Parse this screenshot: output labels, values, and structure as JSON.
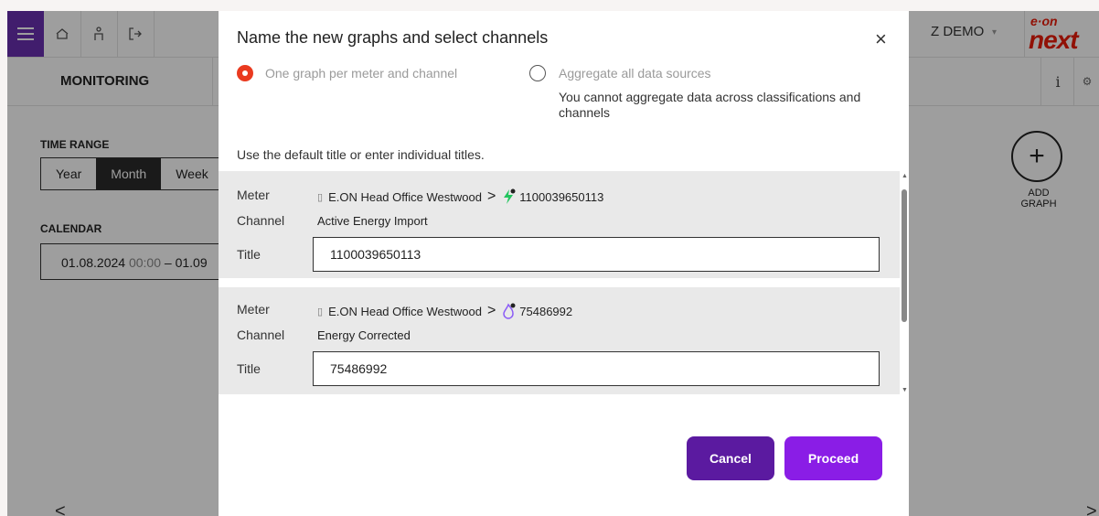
{
  "colors": {
    "brand_purple": "#6a2fb0",
    "eon_red": "#ea1c0a",
    "radio_active": "#ea3a1f",
    "cancel_bg": "#5b1aa0",
    "proceed_bg": "#8a1de6",
    "electricity_icon": "#22c55e",
    "gas_icon": "#8b5cf6"
  },
  "topbar": {
    "icons": [
      "menu-icon",
      "home-icon",
      "user-icon",
      "logout-icon"
    ],
    "account_label": "Z DEMO",
    "account_arrow": "▾",
    "logo_top": "e·on",
    "logo_bottom": "next"
  },
  "section": {
    "title": "MONITORING",
    "info_label": "i",
    "settings_label": "⚙"
  },
  "time_range": {
    "label": "TIME RANGE",
    "options": [
      "Year",
      "Month",
      "Week"
    ],
    "selected": "Month"
  },
  "calendar": {
    "label": "CALENDAR",
    "start_date": "01.08.2024",
    "start_time": "00:00",
    "separator": " – ",
    "end_date_partial": "01.09"
  },
  "add_graph": {
    "icon": "+",
    "label_line1": "ADD",
    "label_line2": "GRAPH"
  },
  "nav": {
    "prev": "<",
    "next": ">"
  },
  "modal": {
    "title": "Name the new graphs and select channels",
    "close": "×",
    "options": [
      {
        "label": "One graph per meter and channel",
        "selected": true
      },
      {
        "label": "Aggregate all data sources",
        "selected": false
      }
    ],
    "aggregate_note": "You cannot aggregate data across classifications and channels",
    "hint": "Use the default title or enter individual titles.",
    "field_labels": {
      "meter": "Meter",
      "channel": "Channel",
      "title": "Title"
    },
    "entries": [
      {
        "site": "E.ON Head Office Westwood",
        "separator": ">",
        "meter_icon": "electricity-icon",
        "meter_id": "1100039650113",
        "channel": "Active Energy Import",
        "title": "1100039650113"
      },
      {
        "site": "E.ON Head Office Westwood",
        "separator": ">",
        "meter_icon": "gas-icon",
        "meter_id": "75486992",
        "channel": "Energy Corrected",
        "title": "75486992"
      }
    ],
    "cancel_label": "Cancel",
    "proceed_label": "Proceed"
  }
}
